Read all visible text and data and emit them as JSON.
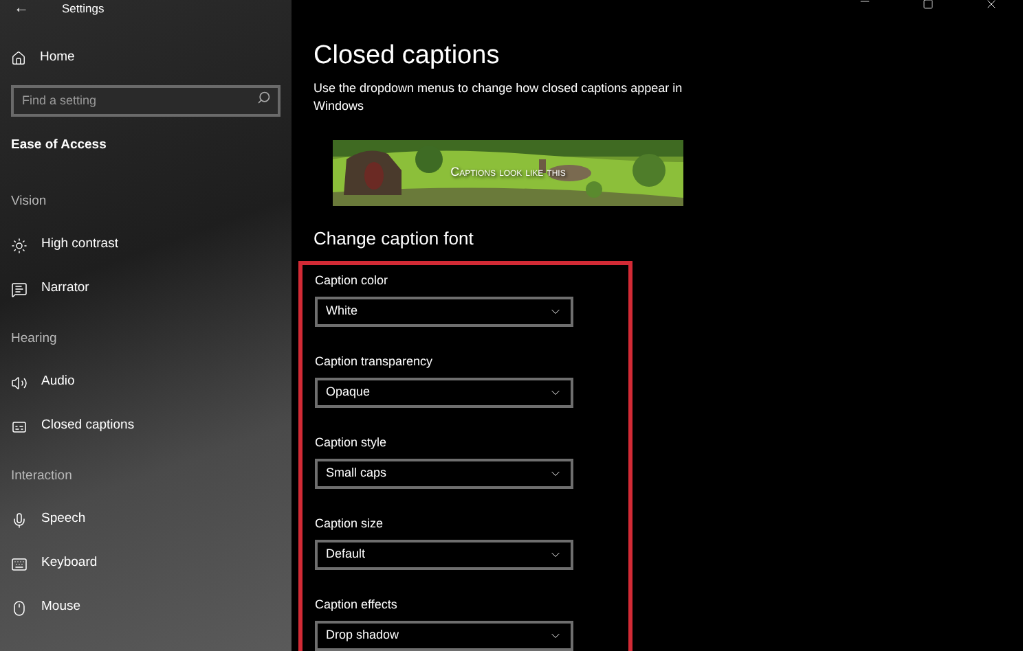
{
  "window": {
    "title": "Settings",
    "back": "←"
  },
  "sidebar": {
    "home": "Home",
    "search": {
      "placeholder": "Find a setting"
    },
    "items": [
      {
        "kind": "category",
        "label": "Ease of Access"
      },
      {
        "kind": "group",
        "label": "Vision"
      },
      {
        "kind": "item",
        "label": "High contrast"
      },
      {
        "kind": "item",
        "label": "Narrator"
      },
      {
        "kind": "group",
        "label": "Hearing"
      },
      {
        "kind": "item",
        "label": "Audio"
      },
      {
        "kind": "item",
        "label": "Closed captions"
      },
      {
        "kind": "group",
        "label": "Interaction"
      },
      {
        "kind": "item",
        "label": "Speech"
      },
      {
        "kind": "item",
        "label": "Keyboard"
      },
      {
        "kind": "item",
        "label": "Mouse"
      }
    ]
  },
  "page": {
    "title": "Closed captions",
    "description": "Use the dropdown menus to change how closed captions appear in Windows",
    "preview": {
      "kind": "picture",
      "caption": "Captions look like this"
    },
    "section": "Change caption font",
    "settings": [
      {
        "label": "Caption color",
        "value": "White"
      },
      {
        "label": "Caption transparency",
        "value": "Opaque"
      },
      {
        "label": "Caption style",
        "value": "Small caps"
      },
      {
        "label": "Caption size",
        "value": "Default"
      },
      {
        "label": "Caption effects",
        "value": "Drop shadow"
      }
    ]
  }
}
